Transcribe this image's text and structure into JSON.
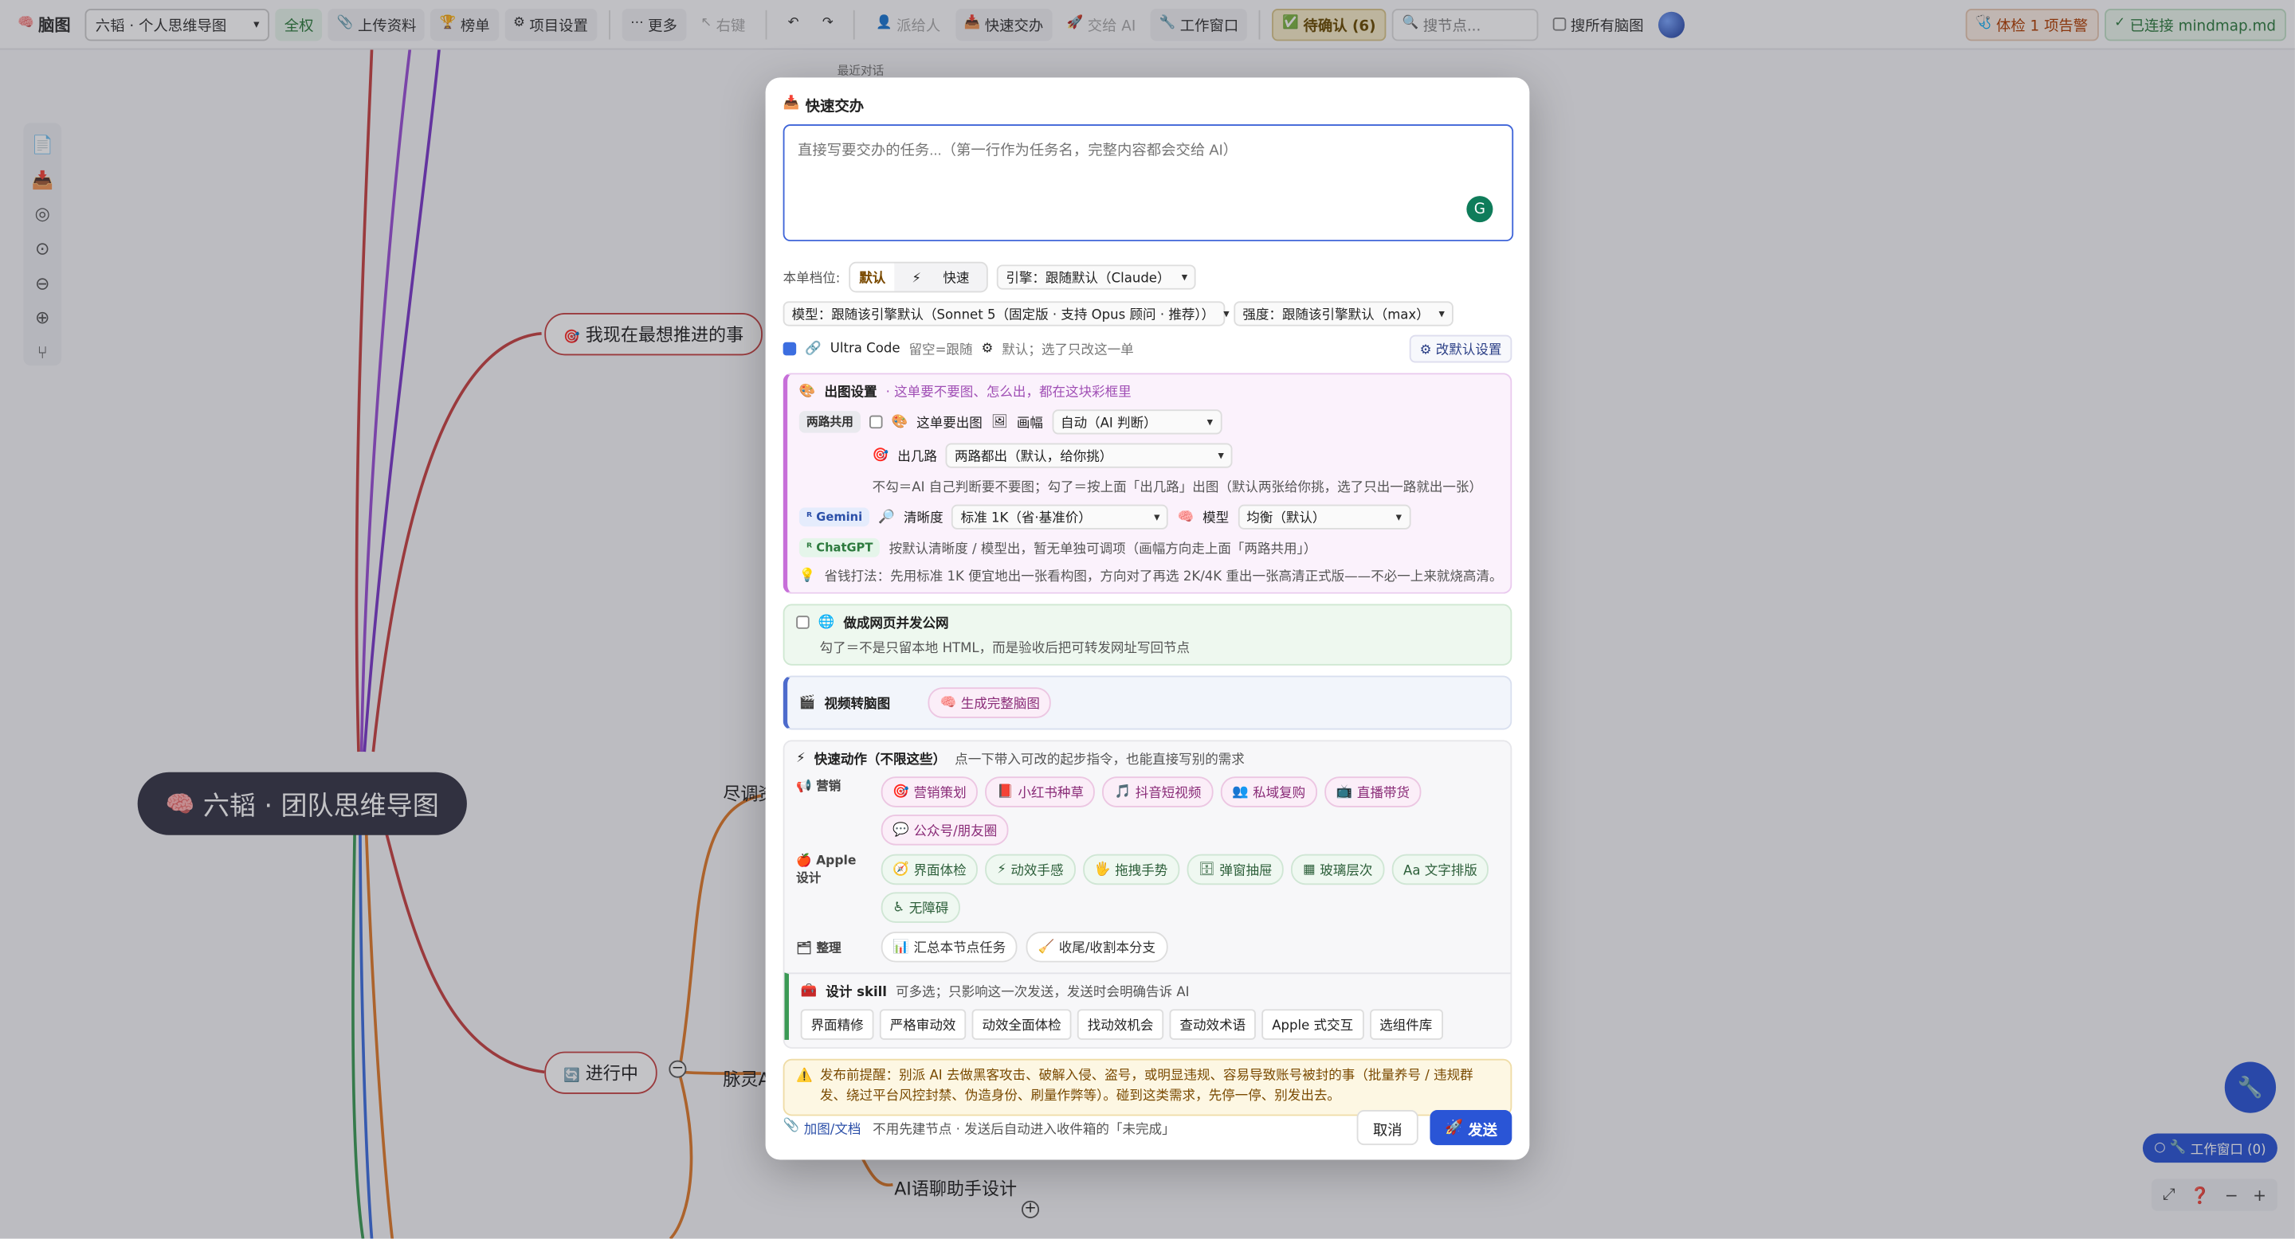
{
  "topbar": {
    "brand": "脑图",
    "map_select": "六韬 · 个人思维导图",
    "perm": "全权",
    "upload": "上传资料",
    "rank": "榜单",
    "project_settings": "项目设置",
    "more": "更多",
    "rightkey": "右键",
    "assign": "派给人",
    "quick_assign": "快速交办",
    "ai_assign": "交给 AI",
    "work_window": "工作窗口",
    "pending": "待确认 (6)",
    "search_placeholder": "搜节点...",
    "search_all": "搜所有脑图",
    "health": "体检 1 项告警",
    "connected": "已连接 mindmap.md"
  },
  "canvas": {
    "recent": "最近对话",
    "node_push": "我现在最想推进的事",
    "root": "六韬 · 团队思维导图",
    "node_inprogress": "进行中",
    "node_jin": "尽调资",
    "node_mai": "脉灵A",
    "node_chat": "AI语聊助手设计",
    "work_window_badge": "工作窗口 (0)"
  },
  "modal": {
    "title": "快速交办",
    "textarea_placeholder": "直接写要交办的任务...（第一行作为任务名，完整内容都会交给 AI）",
    "tier_label": "本单档位:",
    "tier_default": "默认",
    "tier_fast": "快速",
    "engine": "引擎：跟随默认（Claude）",
    "model": "模型：跟随该引擎默认（Sonnet 5（固定版 · 支持 Opus 顾问 · 推荐））",
    "strength": "强度：跟随该引擎默认（max）",
    "ultra_code": "Ultra Code",
    "ultra_note": "留空=跟随",
    "ultra_note2": "默认；选了只改这一单",
    "change_default": "改默认设置",
    "img": {
      "title": "出图设置",
      "subtitle": "· 这单要不要图、怎么出，都在这块彩框里",
      "shared_tag": "两路共用",
      "need_img": "这单要出图",
      "canvas_label": "画幅",
      "canvas_value": "自动（AI 判断）",
      "routes_label": "出几路",
      "routes_value": "两路都出（默认，给你挑）",
      "routes_note": "不勾＝AI 自己判断要不要图；勾了＝按上面「出几路」出图（默认两张给你挑，选了只出一路就出一张）",
      "gemini_tag": "Gemini",
      "clarity_label": "清晰度",
      "clarity_value": "标准 1K（省·基准价）",
      "model_label": "模型",
      "model_value": "均衡（默认）",
      "chatgpt_tag": "ChatGPT",
      "chatgpt_note": "按默认清晰度 / 模型出，暂无单独可调项（画幅方向走上面「两路共用」）",
      "tip": "省钱打法：先用标准 1K 便宜地出一张看构图，方向对了再选 2K/4K 重出一张高清正式版——不必一上来就烧高清。"
    },
    "web": {
      "title": "做成网页并发公网",
      "note": "勾了＝不是只留本地 HTML，而是验收后把可转发网址写回节点"
    },
    "video": {
      "title": "视频转脑图",
      "button": "生成完整脑图"
    },
    "quick": {
      "title": "快速动作（不限这些）",
      "subtitle": "点一下带入可改的起步指令，也能直接写别的需求",
      "marketing_label": "营销",
      "marketing": [
        "营销策划",
        "小红书种草",
        "抖音短视频",
        "私域复购",
        "直播带货",
        "公众号/朋友圈"
      ],
      "apple_label": "Apple 设计",
      "apple": [
        "界面体检",
        "动效手感",
        "拖拽手势",
        "弹窗抽屉",
        "玻璃层次",
        "Aa 文字排版",
        "无障碍"
      ],
      "organize_label": "整理",
      "organize": [
        "汇总本节点任务",
        "收尾/收割本分支"
      ]
    },
    "skill": {
      "title": "设计 skill",
      "subtitle": "可多选；只影响这一次发送，发送时会明确告诉 AI",
      "items": [
        "界面精修",
        "严格审动效",
        "动效全面体检",
        "找动效机会",
        "查动效术语",
        "Apple 式交互",
        "选组件库"
      ]
    },
    "warn": "发布前提醒：别派 AI 去做黑客攻击、破解入侵、盗号，或明显违规、容易导致账号被封的事（批量养号 / 违规群发、绕过平台风控封禁、伪造身份、刷量作弊等）。碰到这类需求，先停一停、别发出去。",
    "footer": {
      "attach": "加图/文档",
      "note": "不用先建节点 · 发送后自动进入收件箱的「未完成」",
      "cancel": "取消",
      "send": "发送"
    }
  },
  "colors": {
    "accent": "#2a55d6",
    "root_bg": "#353546",
    "branch_red": "#c74242"
  }
}
